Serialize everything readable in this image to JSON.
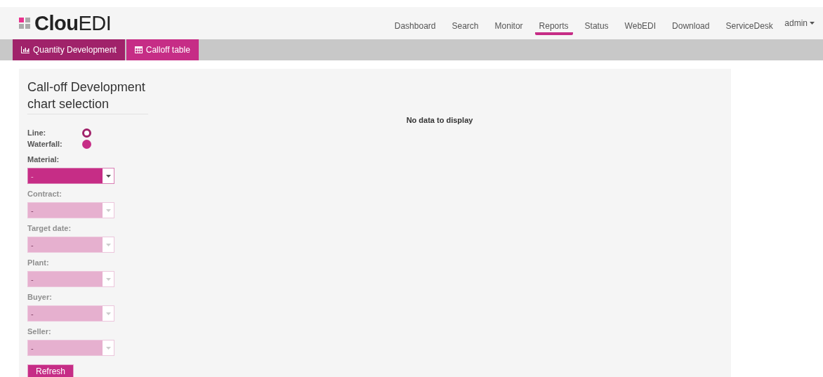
{
  "logo": {
    "bold": "Clou",
    "light": "EDI"
  },
  "nav": [
    {
      "label": "Dashboard",
      "selected": false
    },
    {
      "label": "Search",
      "selected": false
    },
    {
      "label": "Monitor",
      "selected": false
    },
    {
      "label": "Reports",
      "selected": true
    },
    {
      "label": "Status",
      "selected": false
    },
    {
      "label": "WebEDI",
      "selected": false
    },
    {
      "label": "Download",
      "selected": false
    },
    {
      "label": "ServiceDesk",
      "selected": false
    }
  ],
  "user_menu": "admin",
  "tabs": [
    {
      "label": "Quantity Development",
      "kind": "chart",
      "selected": true
    },
    {
      "label": "Calloff table",
      "kind": "table",
      "selected": false
    }
  ],
  "panel": {
    "title": "Call-off Development chart selection",
    "chart_types": [
      {
        "label": "Line:",
        "selected": true
      },
      {
        "label": "Waterfall:",
        "selected": false
      }
    ],
    "fields": [
      {
        "label": "Material:",
        "value": "-",
        "disabled": false
      },
      {
        "label": "Contract:",
        "value": "-",
        "disabled": true
      },
      {
        "label": "Target date:",
        "value": "-",
        "disabled": true
      },
      {
        "label": "Plant:",
        "value": "-",
        "disabled": true
      },
      {
        "label": "Buyer:",
        "value": "-",
        "disabled": true
      },
      {
        "label": "Seller:",
        "value": "-",
        "disabled": true
      }
    ],
    "refresh_button": "Refresh",
    "empty_message": "No data to display"
  }
}
